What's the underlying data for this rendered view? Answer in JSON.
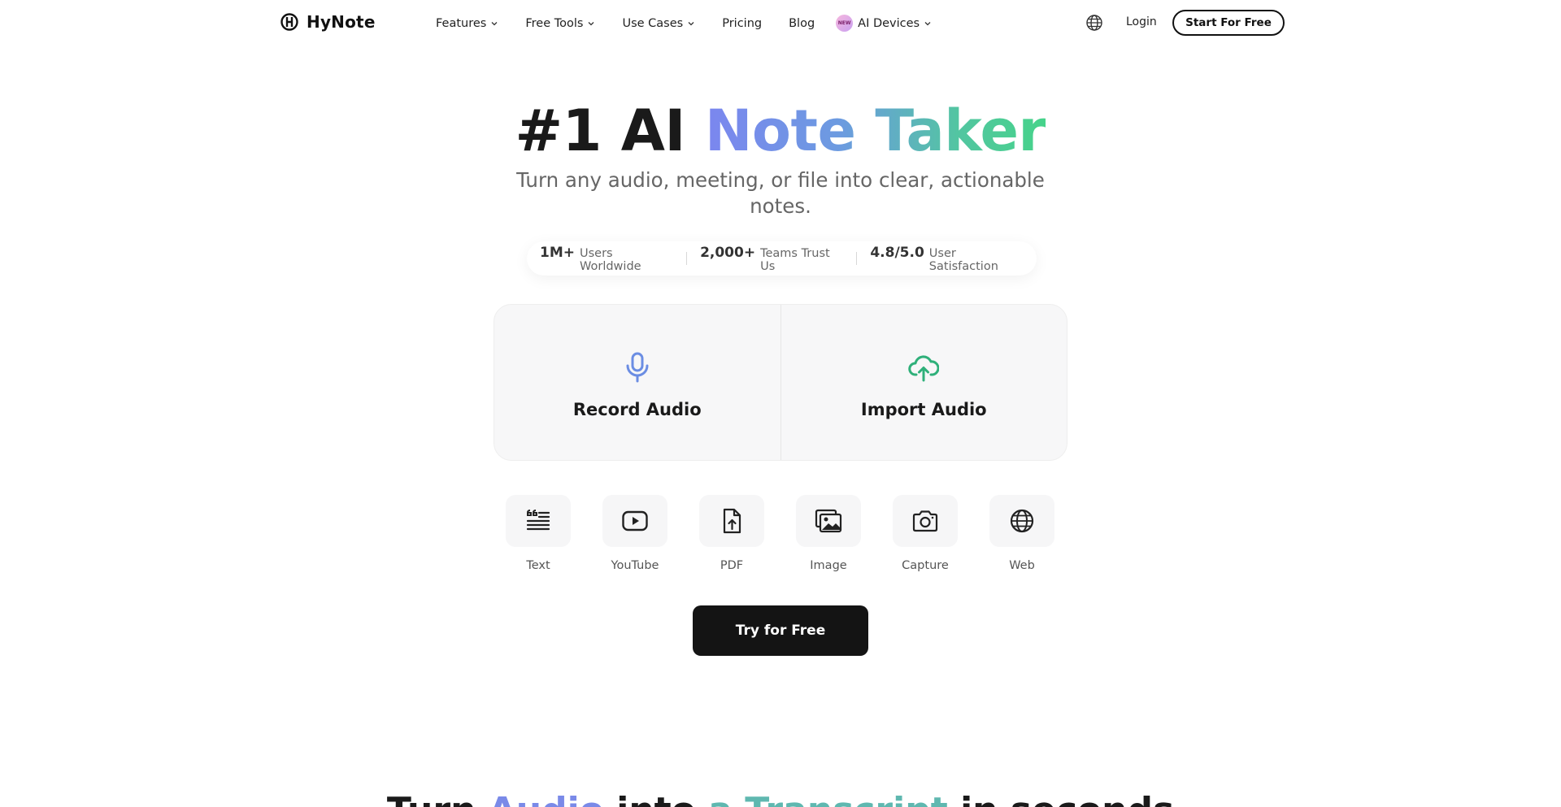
{
  "brand": {
    "name": "HyNote"
  },
  "nav": {
    "items": [
      {
        "label": "Features",
        "has_dropdown": true
      },
      {
        "label": "Free Tools",
        "has_dropdown": true
      },
      {
        "label": "Use Cases",
        "has_dropdown": true
      },
      {
        "label": "Pricing",
        "has_dropdown": false
      },
      {
        "label": "Blog",
        "has_dropdown": false
      }
    ],
    "devices": {
      "badge": "NEW",
      "label": "AI Devices"
    },
    "login": "Login",
    "cta": "Start For Free"
  },
  "hero": {
    "title_plain": "#1 AI",
    "title_gradient": "Note Taker",
    "subtitle_line1": "Turn any audio, meeting, or file into clear, actionable",
    "subtitle_line2": "notes.",
    "gradient_colors": [
      "#7b86ef",
      "#46d38a"
    ]
  },
  "stats": [
    {
      "value": "1M+",
      "label": "Users Worldwide"
    },
    {
      "value": "2,000+",
      "label": "Teams Trust Us"
    },
    {
      "value": "4.8/5.0",
      "label": "User Satisfaction"
    }
  ],
  "cards": [
    {
      "label": "Record Audio",
      "icon": "microphone-icon",
      "color": "#6b8de3"
    },
    {
      "label": "Import Audio",
      "icon": "cloud-upload-icon",
      "color": "#2fb07a"
    }
  ],
  "sources": [
    {
      "label": "Text",
      "icon": "text-quote-icon"
    },
    {
      "label": "YouTube",
      "icon": "youtube-play-icon"
    },
    {
      "label": "PDF",
      "icon": "file-upload-icon"
    },
    {
      "label": "Image",
      "icon": "image-gallery-icon"
    },
    {
      "label": "Capture",
      "icon": "camera-icon"
    },
    {
      "label": "Web",
      "icon": "globe-icon"
    }
  ],
  "try_button": "Try for Free",
  "bottom_heading": {
    "w1": "Turn",
    "w2": "Audio",
    "w3": "into",
    "w4": "a Transcript",
    "w5": "in seconds"
  }
}
